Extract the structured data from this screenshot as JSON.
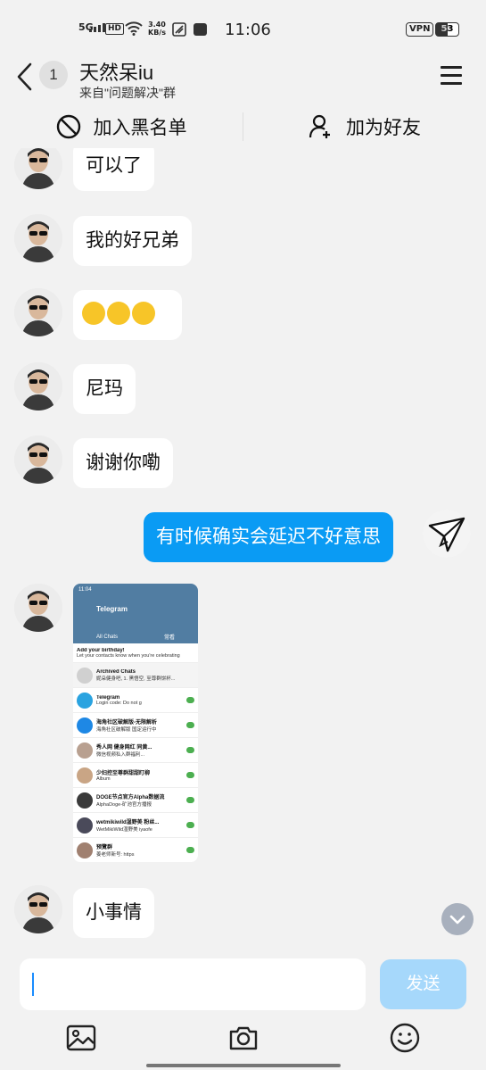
{
  "status_bar": {
    "network": "5G",
    "hd": "HD",
    "speed_value": "3.40",
    "speed_unit": "KB/s",
    "time": "11:06",
    "vpn": "VPN",
    "battery": "53"
  },
  "header": {
    "unread_count": "1",
    "title": "天然呆iu",
    "subtitle": "来自\"问题解决\"群"
  },
  "actions": {
    "block_label": "加入黑名单",
    "add_friend_label": "加为好友"
  },
  "messages": [
    {
      "text": "可以了"
    },
    {
      "text": "我的好兄弟"
    },
    {
      "text": ""
    },
    {
      "text": "尼玛"
    },
    {
      "text": "谢谢你嘞"
    },
    {
      "text": "有时候确实会延迟不好意思"
    },
    {
      "text": "小事情"
    }
  ],
  "screenshot": {
    "time": "11:04",
    "app_title": "Telegram",
    "tab_all": "All Chats",
    "tab_other": "常看",
    "rows": [
      {
        "name": "Add your birthday!",
        "preview": "Let your contacts know when you're celebrating"
      },
      {
        "name": "Archived Chats",
        "preview": "妮朵健身吧, 1. 黑悟空, 至尊群饼杯..."
      },
      {
        "name": "Telegram",
        "preview": "Login code: Do not g"
      },
      {
        "name": "海角社区破解版-无限解析",
        "preview": "海角社区破解版 国定运行中"
      },
      {
        "name": "秀人网 健身网红 同黄...",
        "preview": "微信视频私入群福利..."
      },
      {
        "name": "少妇控至尊群甜甜盯柳",
        "preview": "Album"
      },
      {
        "name": "DOGE节点官方Alpha数据流",
        "preview": "AlphaDoge-矿池官方播报"
      },
      {
        "name": "wetmikiwild湿野美 粉丝...",
        "preview": "WetMikiWild湿野美 iyaofe"
      },
      {
        "name": "预覽群",
        "preview": "姜老师新号: https"
      }
    ]
  },
  "input": {
    "placeholder": "",
    "send_label": "发送"
  },
  "colors": {
    "accent": "#0a9bf4",
    "send_disabled": "#a6d8fb",
    "background": "#f2f2f2"
  }
}
